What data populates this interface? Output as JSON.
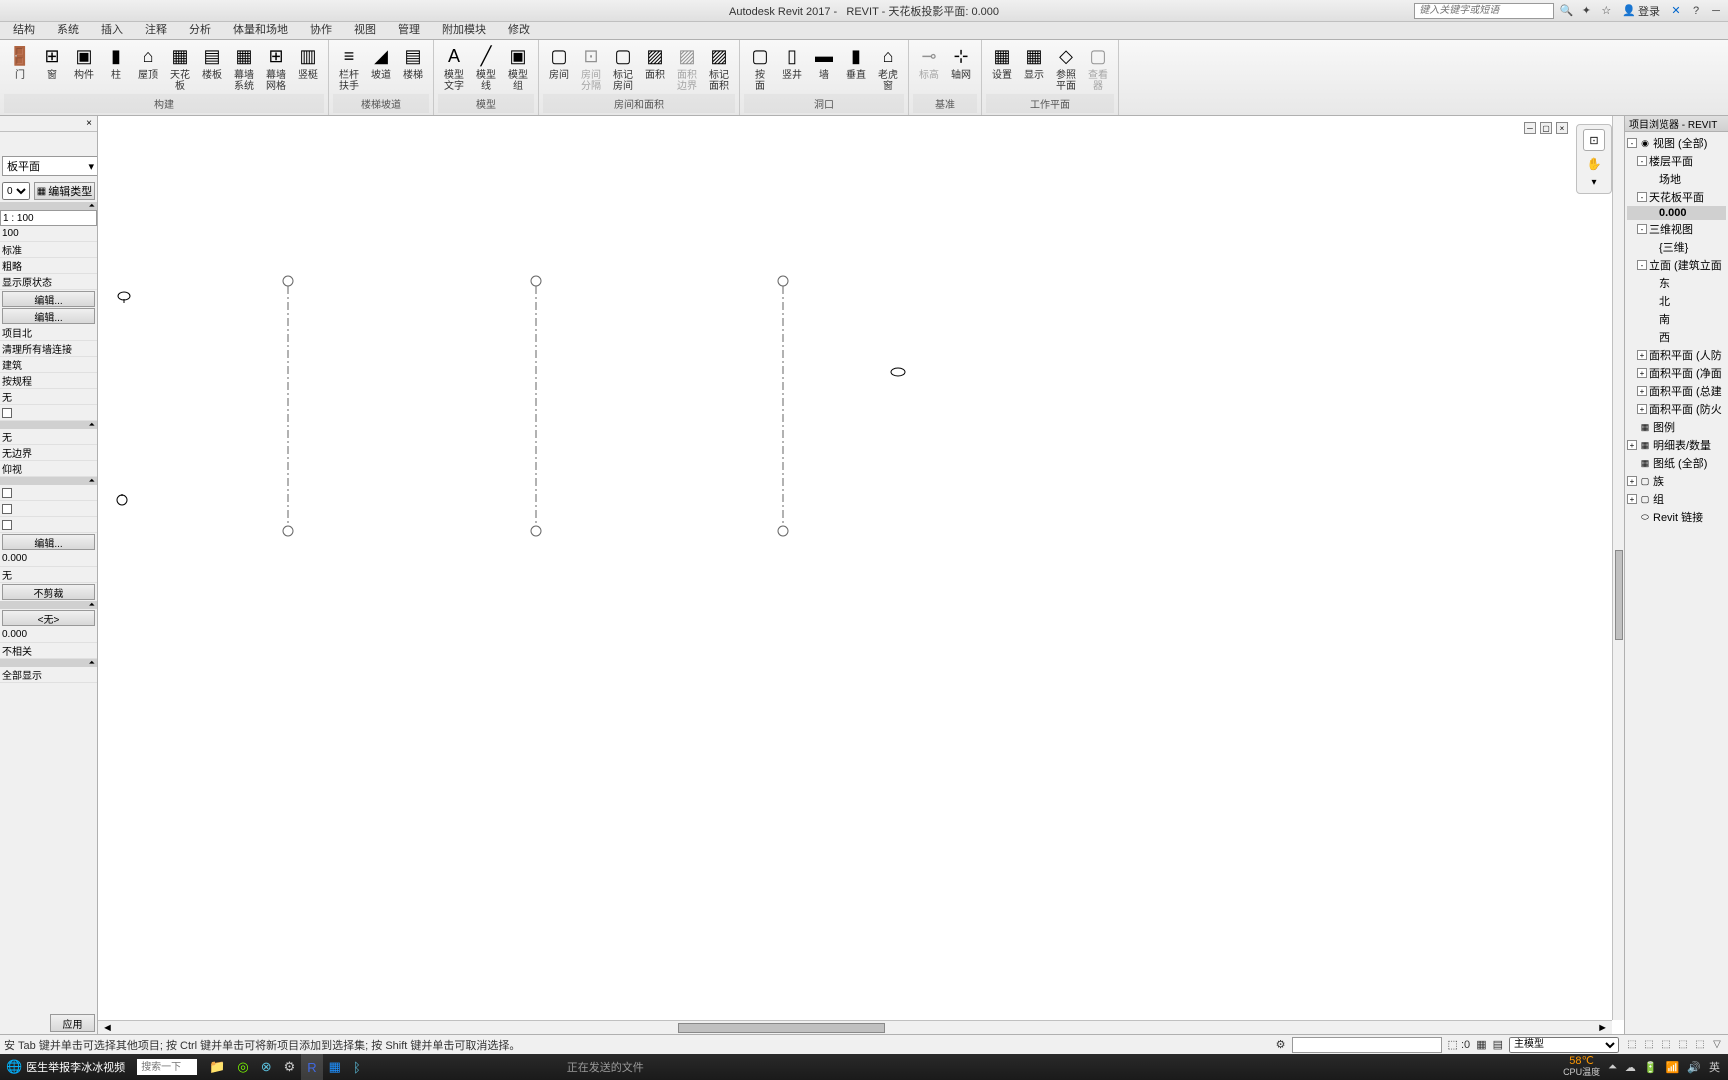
{
  "title": {
    "app": "Autodesk Revit 2017 -",
    "doc": "REVIT - 天花板投影平面: 0.000",
    "search_placeholder": "键入关键字或短语",
    "login": "登录"
  },
  "tabs": [
    "结构",
    "系统",
    "插入",
    "注释",
    "分析",
    "体量和场地",
    "协作",
    "视图",
    "管理",
    "附加模块",
    "修改"
  ],
  "ribbon_groups": [
    {
      "label": "构建",
      "buttons": [
        {
          "label": "门",
          "icon": "door"
        },
        {
          "label": "窗",
          "icon": "window"
        },
        {
          "label": "构件",
          "icon": "component"
        },
        {
          "label": "柱",
          "icon": "column"
        },
        {
          "label": "屋顶",
          "icon": "roof"
        },
        {
          "label": "天花板",
          "icon": "ceiling"
        },
        {
          "label": "楼板",
          "icon": "floor"
        },
        {
          "label": "幕墙\n系统",
          "icon": "curtain"
        },
        {
          "label": "幕墙\n网格",
          "icon": "cgrid"
        },
        {
          "label": "竖梃",
          "icon": "mullion"
        }
      ]
    },
    {
      "label": "楼梯坡道",
      "buttons": [
        {
          "label": "栏杆扶手",
          "icon": "rail"
        },
        {
          "label": "坡道",
          "icon": "ramp"
        },
        {
          "label": "楼梯",
          "icon": "stair"
        }
      ]
    },
    {
      "label": "模型",
      "buttons": [
        {
          "label": "模型\n文字",
          "icon": "mtext"
        },
        {
          "label": "模型\n线",
          "icon": "mline"
        },
        {
          "label": "模型\n组",
          "icon": "mgroup"
        }
      ]
    },
    {
      "label": "房间和面积",
      "buttons": [
        {
          "label": "房间",
          "icon": "room"
        },
        {
          "label": "房间\n分隔",
          "icon": "roomsep",
          "disabled": true
        },
        {
          "label": "标记\n房间",
          "icon": "tagroom"
        },
        {
          "label": "面积",
          "icon": "area"
        },
        {
          "label": "面积\n边界",
          "icon": "areabnd",
          "disabled": true
        },
        {
          "label": "标记\n面积",
          "icon": "tagarea"
        }
      ]
    },
    {
      "label": "洞口",
      "buttons": [
        {
          "label": "按\n面",
          "icon": "byface"
        },
        {
          "label": "竖井",
          "icon": "shaft"
        },
        {
          "label": "墙",
          "icon": "wall"
        },
        {
          "label": "垂直",
          "icon": "vert"
        },
        {
          "label": "老虎窗",
          "icon": "dormer"
        }
      ]
    },
    {
      "label": "基准",
      "buttons": [
        {
          "label": "标高",
          "icon": "level",
          "disabled": true
        },
        {
          "label": "轴网",
          "icon": "grid"
        }
      ]
    },
    {
      "label": "工作平面",
      "buttons": [
        {
          "label": "设置",
          "icon": "set"
        },
        {
          "label": "显示",
          "icon": "show"
        },
        {
          "label": "参照\n平面",
          "icon": "ref"
        },
        {
          "label": "查看器",
          "icon": "viewer",
          "disabled": true
        }
      ]
    }
  ],
  "properties": {
    "type_selector": "板平面",
    "edit_num": "0",
    "edit_type": "编辑类型",
    "rows": [
      {
        "v": "1 : 100",
        "sel": true
      },
      {
        "v": "100"
      },
      {
        "v": "标准"
      },
      {
        "v": "粗略"
      },
      {
        "v": "显示原状态"
      },
      {
        "v": "编辑...",
        "btn": true
      },
      {
        "v": "编辑...",
        "btn": true
      },
      {
        "v": "项目北"
      },
      {
        "v": "清理所有墙连接"
      },
      {
        "v": "建筑"
      },
      {
        "v": "按规程"
      },
      {
        "v": "无"
      },
      {
        "v": "",
        "cb": true
      },
      {
        "sp": true
      },
      {
        "v": "无"
      },
      {
        "v": "无边界"
      },
      {
        "v": "仰视"
      },
      {
        "sp": true
      },
      {
        "v": "",
        "cb": true
      },
      {
        "v": "",
        "cb": true
      },
      {
        "v": "",
        "cb": true
      },
      {
        "v": "编辑...",
        "btn": true
      },
      {
        "v": "0.000"
      },
      {
        "v": "无"
      },
      {
        "v": "不剪裁",
        "btn": true
      },
      {
        "sp": true
      },
      {
        "v": "<无>",
        "btn": true
      },
      {
        "v": "0.000"
      },
      {
        "v": "不相关"
      },
      {
        "sp": true
      },
      {
        "v": "全部显示"
      }
    ],
    "apply": "应用"
  },
  "browser": {
    "title": "项目浏览器 - REVIT",
    "tree": [
      {
        "d": 0,
        "t": "-",
        "i": "◉",
        "l": "视图 (全部)"
      },
      {
        "d": 1,
        "t": "-",
        "l": "楼层平面"
      },
      {
        "d": 2,
        "l": "场地"
      },
      {
        "d": 1,
        "t": "-",
        "l": "天花板平面"
      },
      {
        "d": 2,
        "l": "0.000",
        "sel": true
      },
      {
        "d": 1,
        "t": "-",
        "l": "三维视图"
      },
      {
        "d": 2,
        "l": "{三维}"
      },
      {
        "d": 1,
        "t": "-",
        "l": "立面 (建筑立面"
      },
      {
        "d": 2,
        "l": "东"
      },
      {
        "d": 2,
        "l": "北"
      },
      {
        "d": 2,
        "l": "南"
      },
      {
        "d": 2,
        "l": "西"
      },
      {
        "d": 1,
        "t": "+",
        "l": "面积平面 (人防"
      },
      {
        "d": 1,
        "t": "+",
        "l": "面积平面 (净面"
      },
      {
        "d": 1,
        "t": "+",
        "l": "面积平面 (总建"
      },
      {
        "d": 1,
        "t": "+",
        "l": "面积平面 (防火"
      },
      {
        "d": 0,
        "i": "▦",
        "l": "图例"
      },
      {
        "d": 0,
        "t": "+",
        "i": "▦",
        "l": "明细表/数量"
      },
      {
        "d": 0,
        "i": "▦",
        "l": "图纸 (全部)"
      },
      {
        "d": 0,
        "t": "+",
        "i": "▢",
        "l": "族"
      },
      {
        "d": 0,
        "t": "+",
        "i": "▢",
        "l": "组"
      },
      {
        "d": 0,
        "i": "⬭",
        "l": "Revit 链接"
      }
    ]
  },
  "status": {
    "hint": "安 Tab 键并单击可选择其他项目; 按 Ctrl 键并单击可将新项目添加到选择集; 按 Shift 键并单击可取消选择。",
    "zero": ":0",
    "model": "主模型"
  },
  "taskbar": {
    "items": [
      {
        "icon": "🌐",
        "label": "医生举报李冰冰视频",
        "color": "#0078d7"
      },
      {
        "icon": "",
        "label": "搜索一下",
        "search": true
      },
      {
        "icon": "📁"
      },
      {
        "icon": "◎",
        "color": "#7cfc00"
      },
      {
        "icon": "⊗",
        "color": "#5bc0de"
      },
      {
        "icon": "⚙",
        "color": "#ccc"
      },
      {
        "icon": "R",
        "color": "#4169e1",
        "active": true
      },
      {
        "icon": "▦",
        "color": "#1e90ff"
      },
      {
        "icon": "ᛒ",
        "color": "#5bc0de"
      }
    ],
    "center": "正在发送的文件",
    "temp": "58℃",
    "temp_label": "CPU温度",
    "ime": "英"
  }
}
